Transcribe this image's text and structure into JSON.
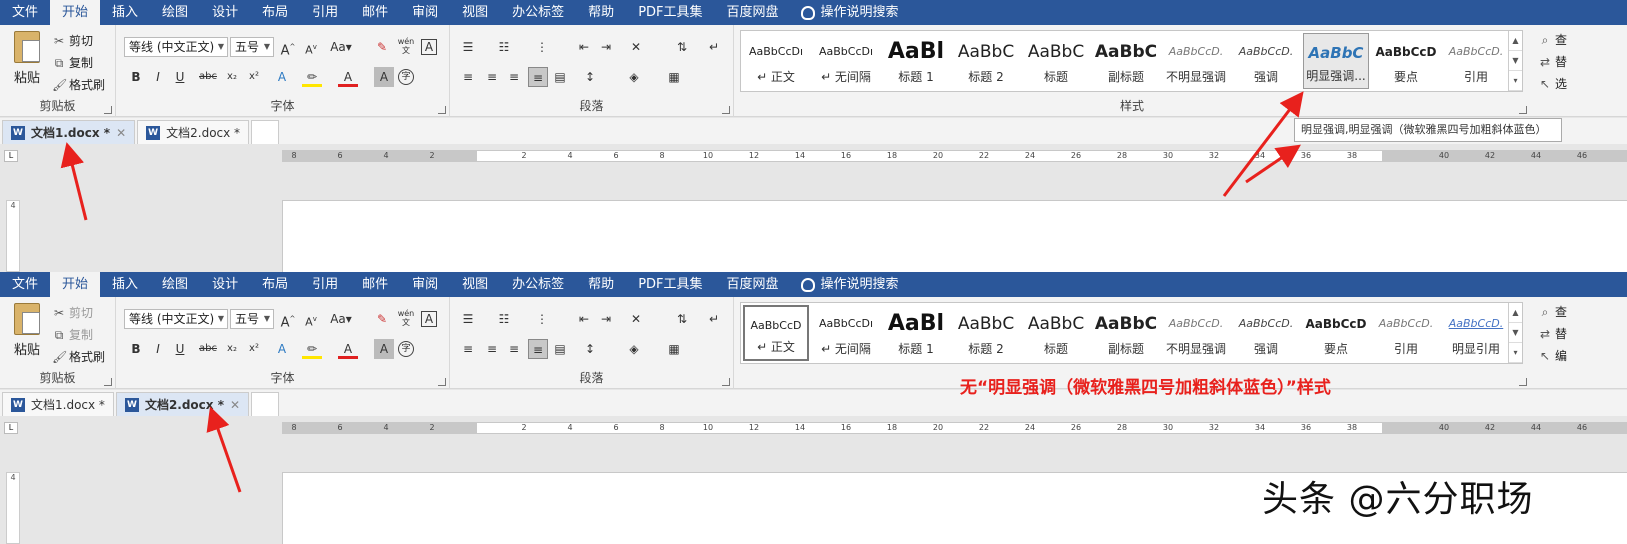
{
  "menu": [
    "文件",
    "开始",
    "插入",
    "绘图",
    "设计",
    "布局",
    "引用",
    "邮件",
    "审阅",
    "视图",
    "办公标签",
    "帮助",
    "PDF工具集",
    "百度网盘"
  ],
  "menu_search": "操作说明搜索",
  "clipboard": {
    "paste": "粘贴",
    "cut": "剪切",
    "copy": "复制",
    "format_painter": "格式刷",
    "label": "剪贴板"
  },
  "font": {
    "name": "等线 (中文正文)",
    "size": "五号",
    "label": "字体",
    "wen": "wén\n文",
    "grow": "A",
    "shrink": "A",
    "case": "Aa"
  },
  "paragraph": {
    "label": "段落"
  },
  "styles_label": "样式",
  "styles_top": [
    {
      "preview": "AaBbCcDı",
      "name": "↵ 正文"
    },
    {
      "preview": "AaBbCcDı",
      "name": "↵ 无间隔"
    },
    {
      "preview": "AaBl",
      "name": "标题 1"
    },
    {
      "preview": "AaBbC",
      "name": "标题 2"
    },
    {
      "preview": "AaBbC",
      "name": "标题"
    },
    {
      "preview": "AaBbC",
      "name": "副标题"
    },
    {
      "preview": "AaBbCcD.",
      "name": "不明显强调"
    },
    {
      "preview": "AaBbCcD.",
      "name": "强调"
    },
    {
      "preview": "AaBbC",
      "name": "明显强调..."
    },
    {
      "preview": "AaBbCcD",
      "name": "要点"
    },
    {
      "preview": "AaBbCcD.",
      "name": "引用"
    }
  ],
  "styles_bottom": [
    {
      "preview": "AaBbCcD",
      "name": "↵ 正文"
    },
    {
      "preview": "AaBbCcDı",
      "name": "↵ 无间隔"
    },
    {
      "preview": "AaBl",
      "name": "标题 1"
    },
    {
      "preview": "AaBbC",
      "name": "标题 2"
    },
    {
      "preview": "AaBbC",
      "name": "标题"
    },
    {
      "preview": "AaBbC",
      "name": "副标题"
    },
    {
      "preview": "AaBbCcD.",
      "name": "不明显强调"
    },
    {
      "preview": "AaBbCcD.",
      "name": "强调"
    },
    {
      "preview": "AaBbCcD",
      "name": "要点"
    },
    {
      "preview": "AaBbCcD.",
      "name": "引用"
    },
    {
      "preview": "AaBbCcD.",
      "name": "明显引用"
    }
  ],
  "right_partial_top": [
    "查",
    "替",
    "选",
    "编"
  ],
  "tabs_top": [
    {
      "label": "文档1.docx *",
      "active": true
    },
    {
      "label": "文档2.docx *",
      "active": false
    }
  ],
  "tabs_bottom": [
    {
      "label": "文档1.docx *",
      "active": false
    },
    {
      "label": "文档2.docx *",
      "active": true
    }
  ],
  "tooltip": "明显强调,明显强调（微软雅黑四号加粗斜体蓝色）",
  "annotation": "无“明显强调（微软雅黑四号加粗斜体蓝色）”样式",
  "watermark": "头条 @六分职场",
  "ruler_ticks": [
    "8",
    "6",
    "4",
    "2",
    "",
    "2",
    "4",
    "6",
    "8",
    "10",
    "12",
    "14",
    "16",
    "18",
    "20",
    "22",
    "24",
    "26",
    "28",
    "30",
    "32",
    "34",
    "36",
    "38",
    "",
    "40",
    "42",
    "44",
    "46"
  ],
  "vruler_label": "4",
  "colors": {
    "menubar": "#2b579a",
    "accent_red": "#e8211d",
    "intense_blue": "#2e74b5"
  }
}
